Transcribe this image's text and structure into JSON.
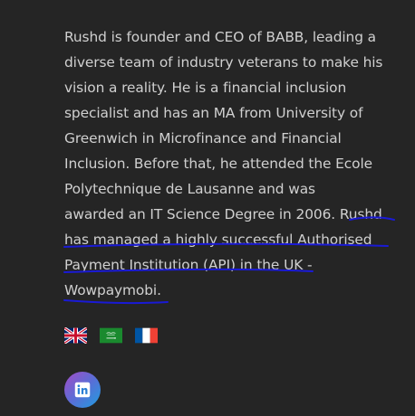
{
  "bio": {
    "lines": [
      "Rushd is founder and CEO of BABB, leading a",
      "diverse team of industry veterans to make his",
      "vision a reality. He is a financial inclusion",
      "specialist and has an MA from University of",
      "Greenwich in Microfinance and Financial",
      "Inclusion. Before that, he attended the Ecole",
      "Polytechnique de Lausanne and was",
      "awarded an IT Science Degree in 2006. Rushd",
      "has managed a highly successful Authorised",
      "Payment Institution (API) in the UK -",
      "Wowpaymobi."
    ],
    "text_color": "#d0d0d0",
    "annotation_color": "#1a1ad6"
  },
  "languages": [
    {
      "name": "English",
      "icon": "uk-flag-icon"
    },
    {
      "name": "Arabic",
      "icon": "saudi-flag-icon"
    },
    {
      "name": "French",
      "icon": "france-flag-icon"
    }
  ],
  "social": {
    "icon": "linkedin-icon",
    "label": "in"
  },
  "colors": {
    "background": "#252525"
  }
}
